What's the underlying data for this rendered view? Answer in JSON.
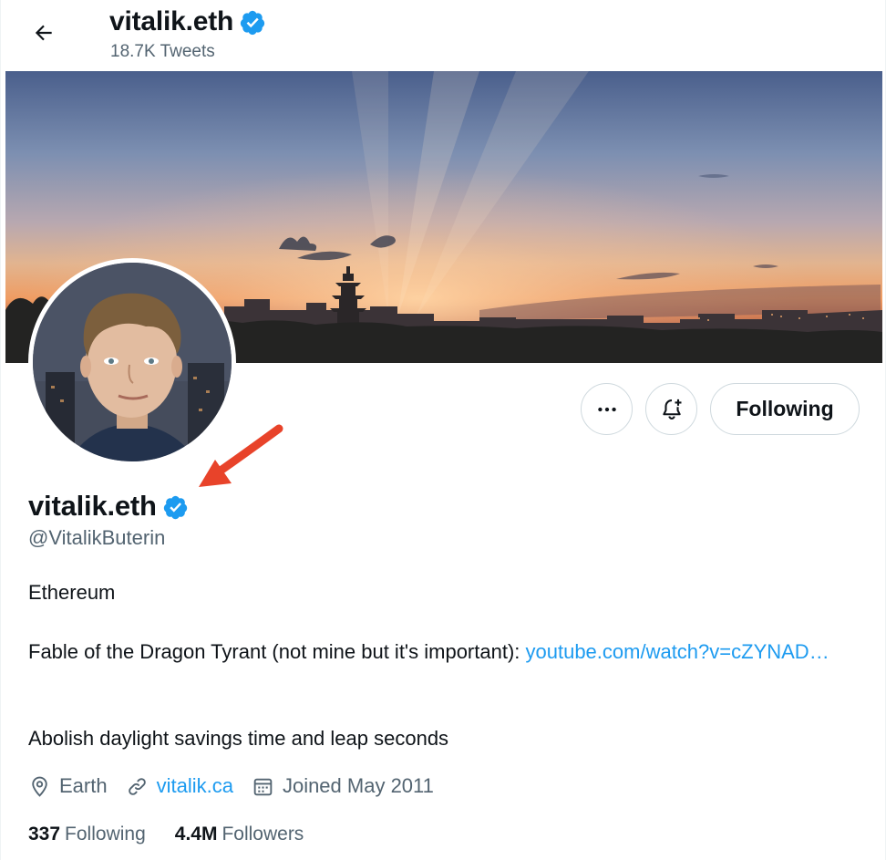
{
  "header": {
    "back_icon": "arrow-left-icon",
    "name": "vitalik.eth",
    "verified_icon": "verified-badge-icon",
    "tweet_count": "18.7K Tweets"
  },
  "actions": {
    "more_icon": "more-horizontal-icon",
    "notify_icon": "bell-plus-icon",
    "following_label": "Following"
  },
  "profile": {
    "name": "vitalik.eth",
    "handle": "@VitalikButerin",
    "bio": {
      "line1": "Ethereum",
      "line2_text": "Fable of the Dragon Tyrant (not mine but it's important): ",
      "line2_link": "youtube.com/watch?v=cZYNAD…",
      "line3": "Abolish daylight savings time and leap seconds"
    },
    "location": "Earth",
    "website": "vitalik.ca",
    "joined": "Joined May 2011",
    "following_count": "337",
    "following_label": "Following",
    "followers_count": "4.4M",
    "followers_label": "Followers"
  },
  "colors": {
    "accent": "#1d9bf0",
    "text_primary": "#0f1419",
    "text_secondary": "#536471",
    "annotation": "#e8432a"
  }
}
